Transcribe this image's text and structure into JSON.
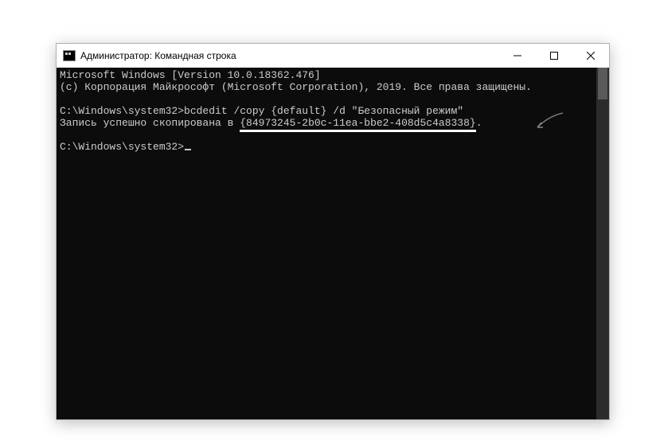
{
  "titlebar": {
    "title": "Администратор: Командная строка"
  },
  "console": {
    "line1": "Microsoft Windows [Version 10.0.18362.476]",
    "line2": "(c) Корпорация Майкрософт (Microsoft Corporation), 2019. Все права защищены.",
    "prompt1_prefix": "C:\\Windows\\system32>",
    "command1": "bcdedit /copy {default} /d \"Безопасный режим\"",
    "result_prefix": "Запись успешно скопирована в ",
    "result_guid": "{84973245-2b0c-11ea-bbe2-408d5c4a8338}",
    "result_suffix": ".",
    "prompt2": "C:\\Windows\\system32>"
  }
}
